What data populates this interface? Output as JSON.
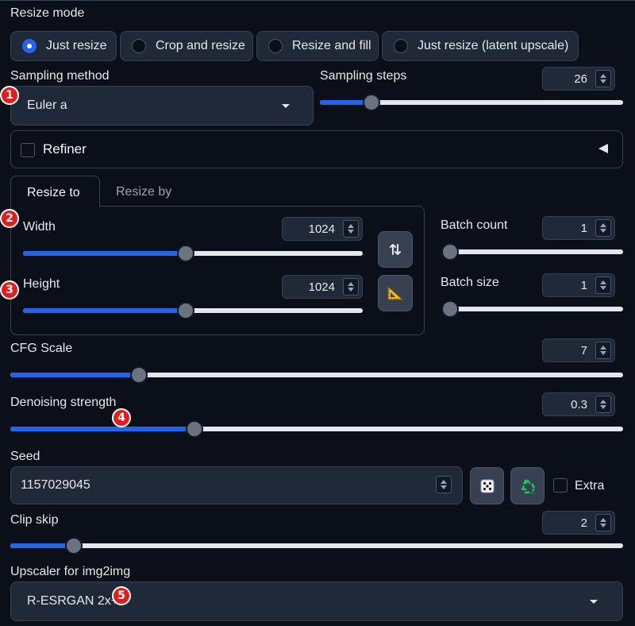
{
  "resize_mode": {
    "label": "Resize mode",
    "options": [
      "Just resize",
      "Crop and resize",
      "Resize and fill",
      "Just resize (latent upscale)"
    ],
    "selected": "Just resize"
  },
  "sampling": {
    "method_label": "Sampling method",
    "method_value": "Euler a",
    "steps_label": "Sampling steps",
    "steps_value": "26",
    "steps_fraction": 0.17
  },
  "refiner": {
    "label": "Refiner",
    "checked": false
  },
  "dimensions": {
    "tabs": [
      "Resize to",
      "Resize by"
    ],
    "active_tab": "Resize to",
    "width_label": "Width",
    "width_value": "1024",
    "width_fraction": 0.48,
    "height_label": "Height",
    "height_value": "1024",
    "height_fraction": 0.48,
    "swap_icon": "swap-arrows-icon",
    "ratio_icon": "triangle-ruler-icon"
  },
  "batch": {
    "count_label": "Batch count",
    "count_value": "1",
    "count_fraction": 0,
    "size_label": "Batch size",
    "size_value": "1",
    "size_fraction": 0
  },
  "cfg": {
    "label": "CFG Scale",
    "value": "7",
    "fraction": 0.21
  },
  "denoise": {
    "label": "Denoising strength",
    "value": "0.3",
    "fraction": 0.3
  },
  "seed": {
    "label": "Seed",
    "value": "1157029045",
    "random_icon": "dice-icon",
    "reuse_icon": "recycle-icon",
    "extra_label": "Extra"
  },
  "clip_skip": {
    "label": "Clip skip",
    "value": "2",
    "fraction": 0.1
  },
  "upscaler": {
    "label": "Upscaler for img2img",
    "value": "R-ESRGAN 2x+"
  },
  "annotations": [
    "1",
    "2",
    "3",
    "4",
    "5"
  ],
  "colors": {
    "accent": "#2563eb",
    "badge": "#e11d1d",
    "background": "#0b0f19",
    "panel": "#1f2937"
  }
}
